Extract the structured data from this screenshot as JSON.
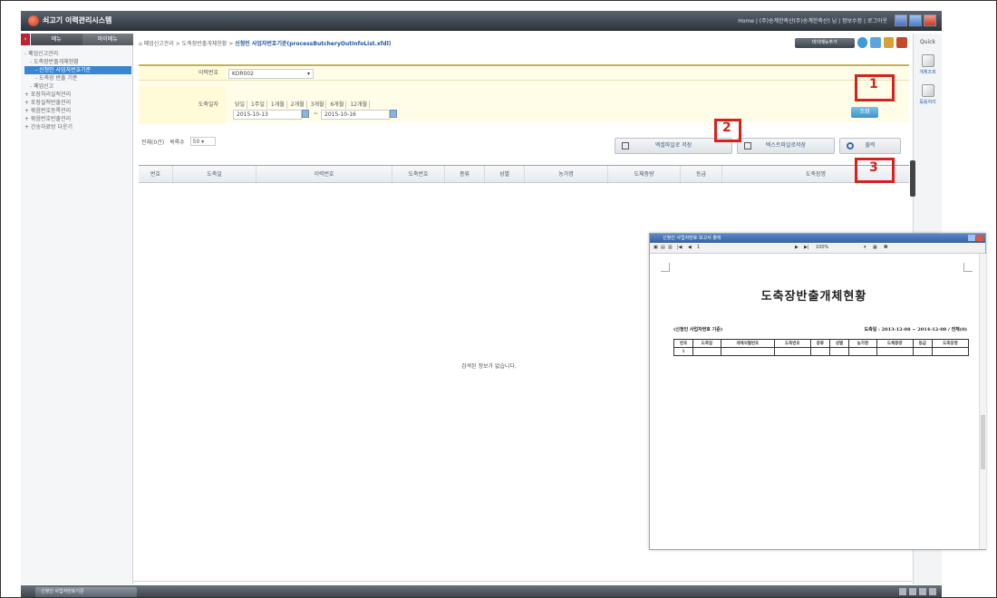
{
  "app": {
    "title": "쇠고기 이력관리시스템",
    "userbar": "Home | (주)송계한축산(주)송계한축산) 님  | 정보수정 | 로그아웃"
  },
  "sidebar": {
    "collapse": "‹",
    "tabs": [
      "메뉴",
      "마이메뉴"
    ],
    "items": [
      {
        "label": "- 폐업신고관리",
        "level": 1
      },
      {
        "label": "- 도축장반출개체현황",
        "level": 2
      },
      {
        "label": "- 신청인 사업자번호기준",
        "level": 3,
        "active": true
      },
      {
        "label": "- 도축장 반출 기준",
        "level": 3
      },
      {
        "label": "- 폐업신고",
        "level": 2
      },
      {
        "label": "+ 포장처리실적관리",
        "level": 1
      },
      {
        "label": "+ 포장실적반출관리",
        "level": 1
      },
      {
        "label": "+ 묶음번호등록관리",
        "level": 1
      },
      {
        "label": "+ 묶음번호반출관리",
        "level": 1
      },
      {
        "label": "+ 간송자료방 다운기",
        "level": 1
      }
    ]
  },
  "header": {
    "crumb_prefix": "폐업신고관리 > 도축장반출개체현황 > ",
    "crumb_current": "신청인 사업자번호기준(processButcheryOutInfoList.xfdl)",
    "fav_label": "마이메뉴추가"
  },
  "quick": {
    "title": "Quick",
    "items": [
      "개체조회",
      "묶음처리"
    ]
  },
  "form": {
    "history_label": "이력번호",
    "history_value": "KOR002",
    "period_label": "도축일자",
    "period_options": [
      "당일",
      "1주일",
      "1개월",
      "2개월",
      "3개월",
      "6개월",
      "12개월"
    ],
    "date_from": "2015-10-13",
    "date_to": "2015-10-16",
    "tilde": "~",
    "search_label": "조회"
  },
  "list": {
    "total": "전체(0건)",
    "rows_label": "목록수",
    "rows_value": "50",
    "excel_label": "엑셀파일로 저장",
    "text_label": "텍스트파일로저장",
    "print_label": "출력",
    "columns": [
      "번호",
      "도축일",
      "이력번호",
      "도축번호",
      "종류",
      "성별",
      "농가명",
      "도체중량",
      "등급",
      "도축장명"
    ],
    "empty_message": "검색된 정보가 없습니다."
  },
  "callouts": [
    "1",
    "2",
    "3"
  ],
  "report": {
    "window_title": "신청인 사업자번호 보고서 출력",
    "page": "1",
    "zoom": "100%",
    "heading": "도축장반출개체현황",
    "subtitle": "(신청인 사업자번호 기준)",
    "info": "도축일 : 2013-12-08  ~  2014-12-08 / 전체(0)",
    "columns": [
      "번호",
      "도축일",
      "개체식별번호",
      "도축번호",
      "종류",
      "성별",
      "농가명",
      "도체중량",
      "등급",
      "도축장명"
    ],
    "first_row_no": "1"
  },
  "status": {
    "tab_label": "신청인 사업자번호기준"
  },
  "colors": {
    "accent": "#3a86d1",
    "callout": "#d8201c",
    "form_bg": "#fffde8"
  }
}
